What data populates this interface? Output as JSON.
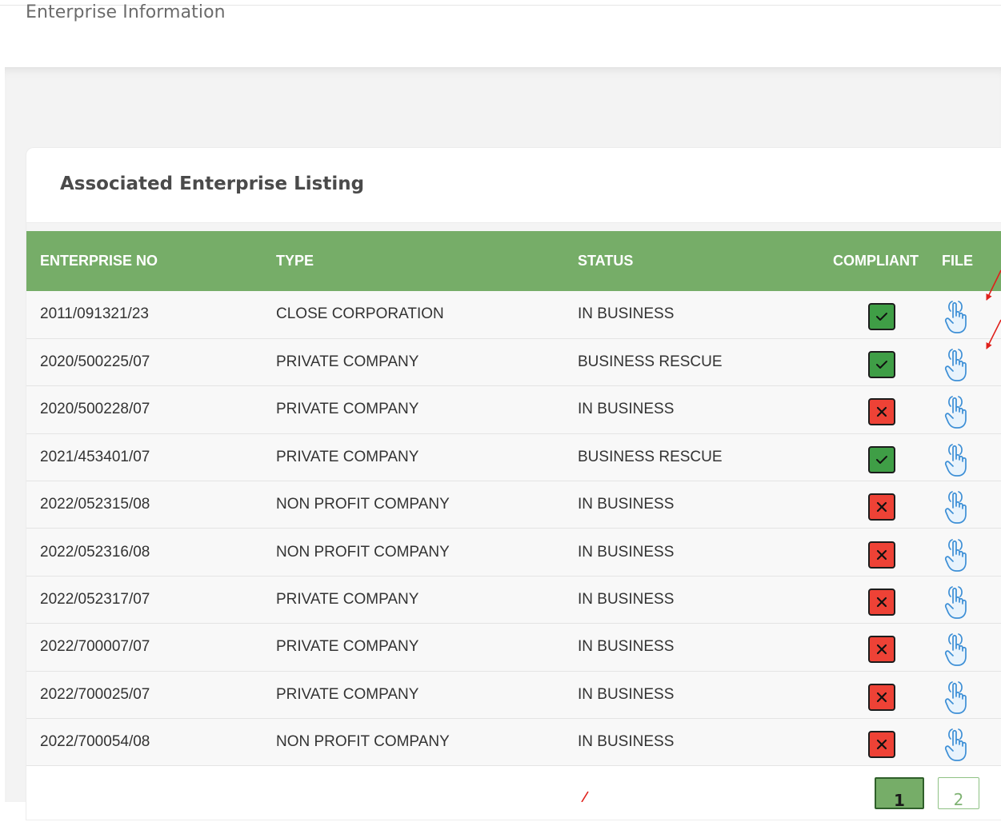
{
  "page": {
    "title": "Enterprise Information"
  },
  "card": {
    "title": "Associated Enterprise Listing"
  },
  "table": {
    "columns": [
      "ENTERPRISE NO",
      "TYPE",
      "STATUS",
      "COMPLIANT",
      "FILE"
    ],
    "rows": [
      {
        "enterprise_no": "2011/091321/23",
        "type": "CLOSE CORPORATION",
        "status": "IN BUSINESS",
        "compliant": true
      },
      {
        "enterprise_no": "2020/500225/07",
        "type": "PRIVATE COMPANY",
        "status": "BUSINESS RESCUE",
        "compliant": true
      },
      {
        "enterprise_no": "2020/500228/07",
        "type": "PRIVATE COMPANY",
        "status": "IN BUSINESS",
        "compliant": false
      },
      {
        "enterprise_no": "2021/453401/07",
        "type": "PRIVATE COMPANY",
        "status": "BUSINESS RESCUE",
        "compliant": true
      },
      {
        "enterprise_no": "2022/052315/08",
        "type": "NON PROFIT COMPANY",
        "status": "IN BUSINESS",
        "compliant": false
      },
      {
        "enterprise_no": "2022/052316/08",
        "type": "NON PROFIT COMPANY",
        "status": "IN BUSINESS",
        "compliant": false
      },
      {
        "enterprise_no": "2022/052317/07",
        "type": "PRIVATE COMPANY",
        "status": "IN BUSINESS",
        "compliant": false
      },
      {
        "enterprise_no": "2022/700007/07",
        "type": "PRIVATE COMPANY",
        "status": "IN BUSINESS",
        "compliant": false
      },
      {
        "enterprise_no": "2022/700025/07",
        "type": "PRIVATE COMPANY",
        "status": "IN BUSINESS",
        "compliant": false
      },
      {
        "enterprise_no": "2022/700054/08",
        "type": "NON PROFIT COMPANY",
        "status": "IN BUSINESS",
        "compliant": false
      }
    ]
  },
  "icons": {
    "compliant_yes": "check-icon",
    "compliant_no": "x-icon",
    "file": "hand-pointer-icon"
  },
  "pagination": {
    "pages": [
      "1",
      "2"
    ],
    "current": "1"
  },
  "colors": {
    "header_green": "#76ad68",
    "compliant_green": "#3f9e46",
    "noncompliant_red": "#ee4236",
    "file_icon_blue": "#3d8fd6",
    "annotation_red": "#e0201b"
  }
}
